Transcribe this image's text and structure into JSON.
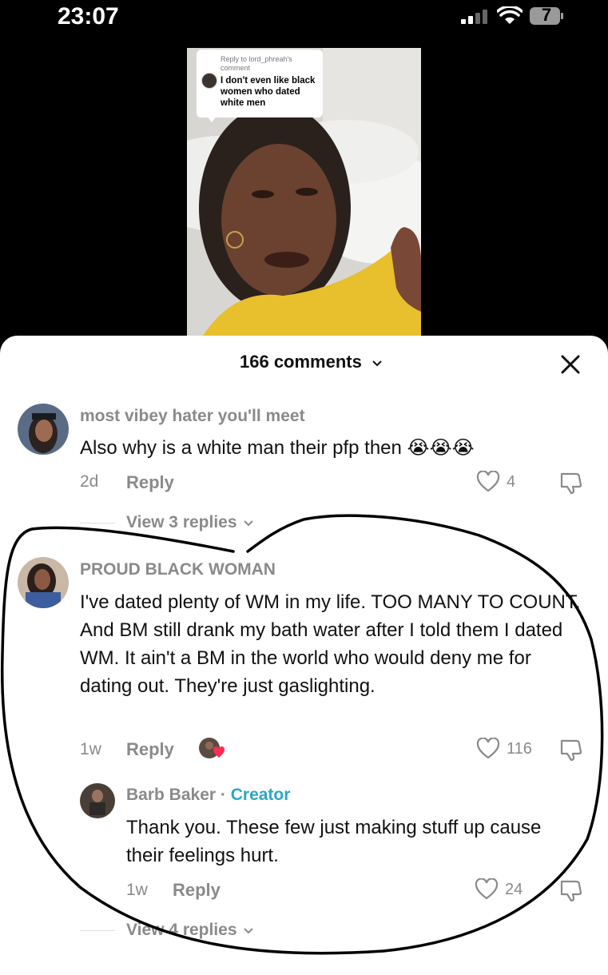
{
  "status_bar": {
    "time": "23:07",
    "battery": "7"
  },
  "video": {
    "reply_to": "Reply to lord_phreah's comment",
    "quoted_comment": "I don't even like black women who dated white men"
  },
  "sheet": {
    "title": "166 comments",
    "comments": [
      {
        "username": "most vibey hater you'll meet",
        "text": "Also why is a white man their pfp then 😭😭😭",
        "age": "2d",
        "reply_label": "Reply",
        "likes": "4",
        "view_replies": "View 3 replies"
      },
      {
        "username": "PROUD BLACK WOMAN",
        "text": "I've dated plenty of WM in my life. TOO MANY TO COUNT. And BM still drank my bath water after I told them I dated WM. It ain't a BM in the world who would deny me for dating out. They're just gaslighting.",
        "age": "1w",
        "reply_label": "Reply",
        "likes": "116"
      }
    ],
    "reply": {
      "username": "Barb Baker",
      "separator": " · ",
      "badge": "Creator",
      "text": "Thank you. These few just making stuff up cause their feelings hurt.",
      "age": "1w",
      "reply_label": "Reply",
      "likes": "24",
      "view_replies": "View 4 replies"
    }
  }
}
